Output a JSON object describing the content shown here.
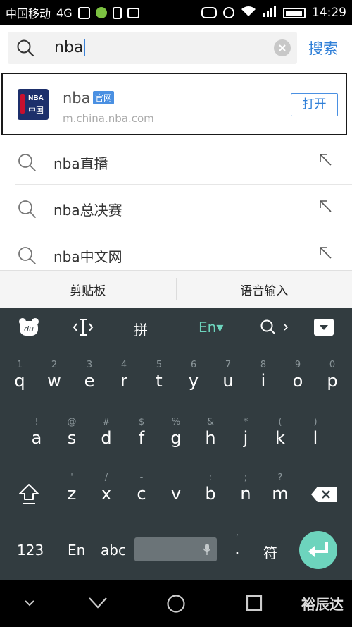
{
  "status_bar": {
    "carrier": "中国移动",
    "network": "4G",
    "time": "14:29",
    "icon_names": [
      "image-icon",
      "app-icon",
      "download-icon",
      "msg-icon",
      "du-icon",
      "alarm-icon",
      "wifi-icon",
      "signal-icon",
      "battery-icon"
    ]
  },
  "search": {
    "query": "nba",
    "submit_label": "搜索"
  },
  "app_result": {
    "logo_top": "NBA",
    "logo_bottom": "中国",
    "name": "nba",
    "tag": "官网",
    "url": "m.china.nba.com",
    "open_label": "打开"
  },
  "suggestions": [
    {
      "label": "nba直播"
    },
    {
      "label": "nba总决赛"
    },
    {
      "label": "nba中文网"
    }
  ],
  "toolbar": {
    "clipboard_label": "剪贴板",
    "voice_input_label": "语音输入"
  },
  "keyboard": {
    "toolbar": {
      "pinyin_label": "拼",
      "lang_label": "En▾"
    },
    "row1": [
      {
        "hint": "1",
        "ch": "q"
      },
      {
        "hint": "2",
        "ch": "w"
      },
      {
        "hint": "3",
        "ch": "e"
      },
      {
        "hint": "4",
        "ch": "r"
      },
      {
        "hint": "5",
        "ch": "t"
      },
      {
        "hint": "6",
        "ch": "y"
      },
      {
        "hint": "7",
        "ch": "u"
      },
      {
        "hint": "8",
        "ch": "i"
      },
      {
        "hint": "9",
        "ch": "o"
      },
      {
        "hint": "0",
        "ch": "p"
      }
    ],
    "row2": [
      {
        "hint": "!",
        "ch": "a"
      },
      {
        "hint": "@",
        "ch": "s"
      },
      {
        "hint": "#",
        "ch": "d"
      },
      {
        "hint": "$",
        "ch": "f"
      },
      {
        "hint": "%",
        "ch": "g"
      },
      {
        "hint": "&",
        "ch": "h"
      },
      {
        "hint": "*",
        "ch": "j"
      },
      {
        "hint": "(",
        "ch": "k"
      },
      {
        "hint": ")",
        "ch": "l"
      }
    ],
    "row3": [
      {
        "hint": "'",
        "ch": "z"
      },
      {
        "hint": "/",
        "ch": "x"
      },
      {
        "hint": "-",
        "ch": "c"
      },
      {
        "hint": "_",
        "ch": "v"
      },
      {
        "hint": ":",
        "ch": "b"
      },
      {
        "hint": ";",
        "ch": "n"
      },
      {
        "hint": "?",
        "ch": "m"
      }
    ],
    "bottom": {
      "num_label": "123",
      "en_label": "En",
      "abc_label": "abc",
      "period_hint": ",",
      "period_label": ".",
      "symbol_label": "符"
    },
    "accent_color": "#6dd4bd"
  },
  "watermark": "裕辰达"
}
